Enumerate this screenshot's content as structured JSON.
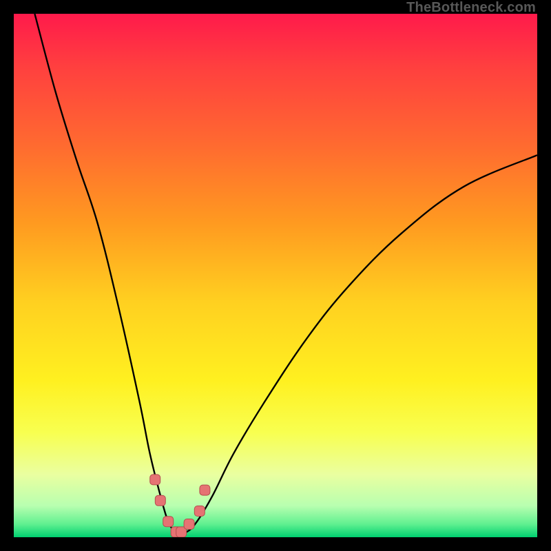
{
  "watermark": "TheBottleneck.com",
  "colors": {
    "frame": "#000000",
    "curve": "#000000",
    "marker_fill": "#e57373",
    "marker_stroke": "#b34d4d",
    "gradient_stops": [
      {
        "offset": 0.0,
        "color": "#ff1a4b"
      },
      {
        "offset": 0.1,
        "color": "#ff3f3f"
      },
      {
        "offset": 0.25,
        "color": "#ff6a30"
      },
      {
        "offset": 0.4,
        "color": "#ff9a20"
      },
      {
        "offset": 0.55,
        "color": "#ffd020"
      },
      {
        "offset": 0.7,
        "color": "#fff020"
      },
      {
        "offset": 0.8,
        "color": "#f8ff50"
      },
      {
        "offset": 0.88,
        "color": "#eaffa0"
      },
      {
        "offset": 0.94,
        "color": "#b8ffb0"
      },
      {
        "offset": 0.975,
        "color": "#60f090"
      },
      {
        "offset": 1.0,
        "color": "#00d070"
      }
    ]
  },
  "chart_data": {
    "type": "line",
    "title": "",
    "xlabel": "",
    "ylabel": "",
    "xlim": [
      0,
      100
    ],
    "ylim": [
      0,
      100
    ],
    "curve": {
      "name": "bottleneck-curve",
      "x": [
        4,
        8,
        12,
        16,
        20,
        24,
        26,
        28,
        29.5,
        31,
        33,
        35,
        38,
        42,
        48,
        56,
        64,
        74,
        86,
        100
      ],
      "y": [
        100,
        85,
        72,
        60,
        44,
        26,
        16,
        8,
        3,
        1,
        1,
        3,
        8,
        16,
        26,
        38,
        48,
        58,
        67,
        73
      ]
    },
    "markers": {
      "name": "highlighted-points",
      "x": [
        27.0,
        28.0,
        29.5,
        31.0,
        32.0,
        33.5,
        35.5,
        36.5
      ],
      "y": [
        11.0,
        7.0,
        3.0,
        1.0,
        1.0,
        2.5,
        5.0,
        9.0
      ]
    }
  }
}
